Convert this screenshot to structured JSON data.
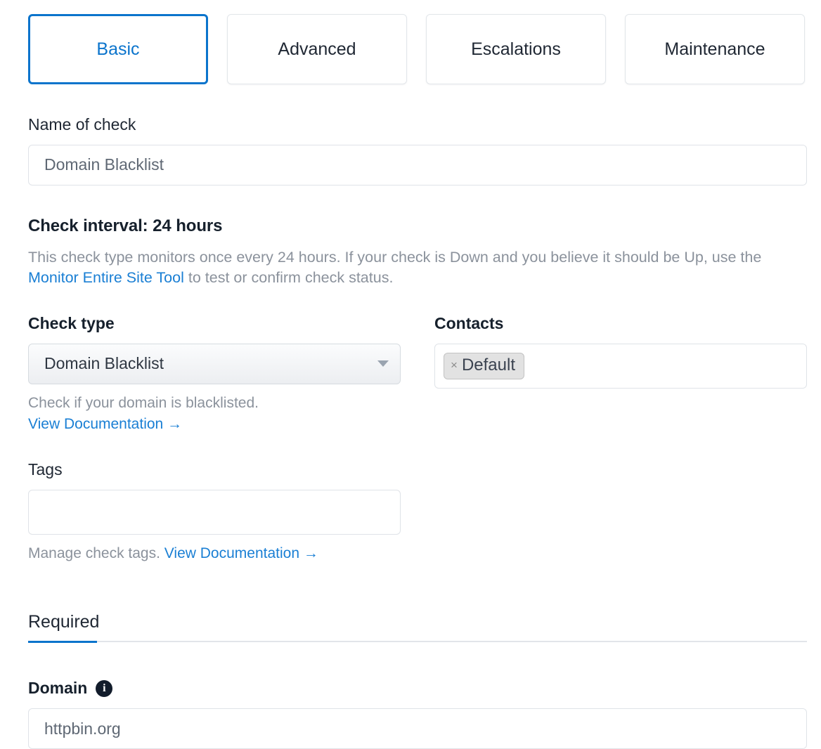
{
  "tabs": [
    {
      "label": "Basic",
      "active": true
    },
    {
      "label": "Advanced",
      "active": false
    },
    {
      "label": "Escalations",
      "active": false
    },
    {
      "label": "Maintenance",
      "active": false
    }
  ],
  "name_of_check": {
    "label": "Name of check",
    "placeholder": "Domain Blacklist",
    "value": ""
  },
  "check_interval": {
    "title": "Check interval: 24 hours",
    "desc_part1": "This check type monitors once every 24 hours. If your check is Down and you believe it should be Up, use the ",
    "link_text": "Monitor Entire Site Tool",
    "desc_part2": " to test or confirm check status."
  },
  "check_type": {
    "label": "Check type",
    "selected": "Domain Blacklist",
    "help": "Check if your domain is blacklisted.",
    "doc_link": "View Documentation →",
    "caret_icon": "chevron-down-icon"
  },
  "contacts": {
    "label": "Contacts",
    "pills": [
      {
        "remove_icon": "×",
        "label": "Default"
      }
    ]
  },
  "tags": {
    "label": "Tags",
    "value": "",
    "help_prefix": "Manage check tags. ",
    "doc_link": "View Documentation →"
  },
  "required_section": {
    "tab_label": "Required",
    "domain_label": "Domain",
    "info_icon": "info-icon",
    "info_glyph": "i",
    "domain_placeholder": "httpbin.org",
    "domain_value": ""
  },
  "colors": {
    "accent_blue": "#0b74cc",
    "link_blue": "#1a7fd4",
    "muted_text": "#8b929c",
    "heading": "#16202c",
    "border": "#dfe3e8"
  }
}
